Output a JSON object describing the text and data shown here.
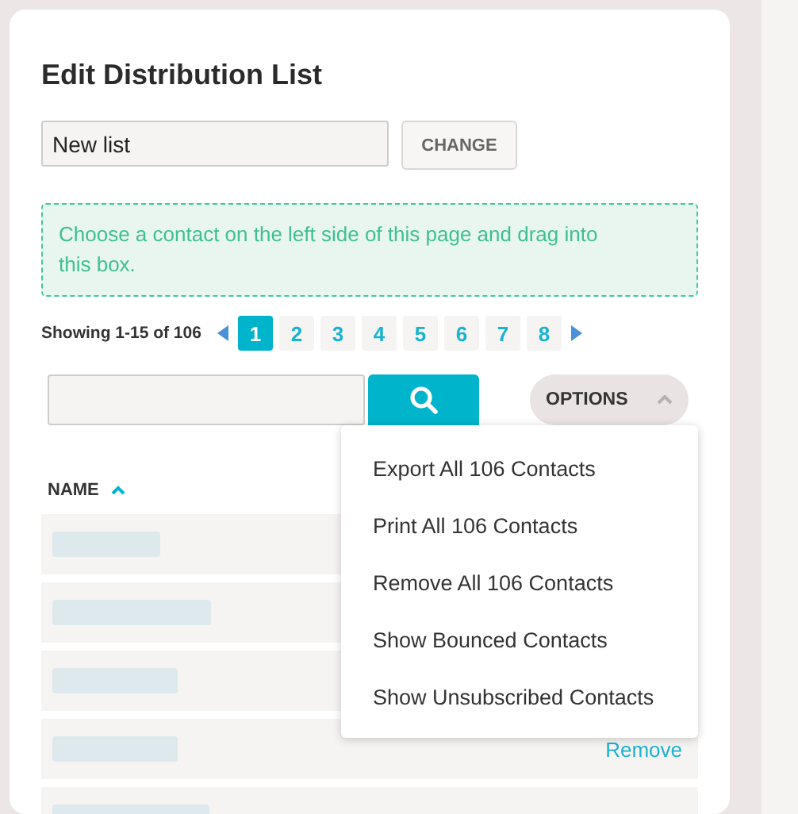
{
  "title": "Edit Distribution List",
  "list_name": {
    "value": "New list"
  },
  "change_button": "CHANGE",
  "drop_zone": "Choose a contact on the left side of this page and drag into this box.",
  "pagination": {
    "summary": "Showing 1-15 of 106",
    "pages": [
      {
        "label": "1",
        "selected": true
      },
      {
        "label": "2",
        "selected": false
      },
      {
        "label": "3",
        "selected": false
      },
      {
        "label": "4",
        "selected": false
      },
      {
        "label": "5",
        "selected": false
      },
      {
        "label": "6",
        "selected": false
      },
      {
        "label": "7",
        "selected": false
      },
      {
        "label": "8",
        "selected": false
      }
    ]
  },
  "options": {
    "label": "OPTIONS",
    "expanded": true,
    "items": [
      "Export All 106 Contacts",
      "Print All 106 Contacts",
      "Remove All 106 Contacts",
      "Show Bounced Contacts",
      "Show Unsubscribed Contacts"
    ]
  },
  "table": {
    "columns": [
      {
        "label": "NAME",
        "sorted": true
      }
    ],
    "rows": [
      {},
      {},
      {},
      {
        "action": "Remove"
      },
      {}
    ]
  }
}
